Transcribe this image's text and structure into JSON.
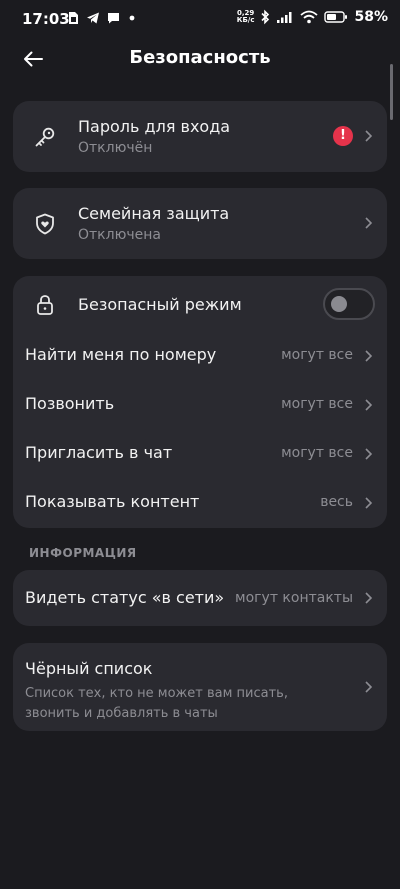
{
  "status_bar": {
    "time": "17:03",
    "net_speed_value": "0,29",
    "net_speed_unit": "КБ/с",
    "battery": "58%",
    "icons": [
      "sim-icon",
      "telegram-icon",
      "message-icon",
      "more-dots-icon",
      "bluetooth-icon",
      "signal-icon",
      "wifi-icon",
      "battery-icon"
    ]
  },
  "header": {
    "title": "Безопасность",
    "back_icon": "arrow-left-icon"
  },
  "password": {
    "title": "Пароль для входа",
    "subtitle": "Отключён",
    "badge": "!"
  },
  "family": {
    "title": "Семейная защита",
    "subtitle": "Отключена"
  },
  "safe_mode": {
    "title": "Безопасный режим",
    "enabled": false
  },
  "privacy_rows": [
    {
      "label": "Найти меня по номеру",
      "value": "могут все"
    },
    {
      "label": "Позвонить",
      "value": "могут все"
    },
    {
      "label": "Пригласить в чат",
      "value": "могут все"
    },
    {
      "label": "Показывать контент",
      "value": "весь"
    }
  ],
  "info_section": {
    "header": "ИНФОРМАЦИЯ"
  },
  "online_status": {
    "label": "Видеть статус «в сети»",
    "value": "могут контакты"
  },
  "blacklist": {
    "title": "Чёрный список",
    "description": "Список тех, кто не может вам писать, звонить и добавлять в чаты"
  },
  "colors": {
    "background": "#1b1b1f",
    "card": "#2a2a30",
    "text_primary": "#f2f2f2",
    "text_secondary": "#8d8d93",
    "alert": "#e5334b"
  }
}
